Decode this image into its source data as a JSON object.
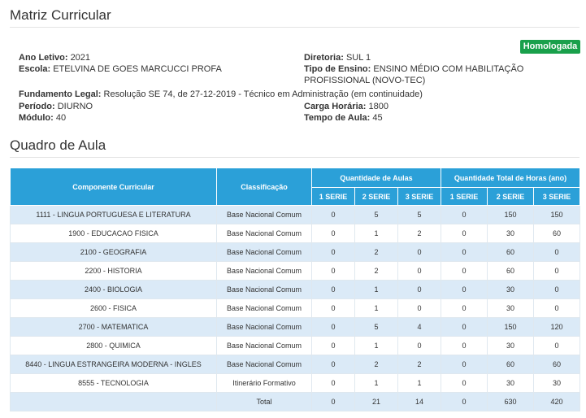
{
  "page_title": "Matriz Curricular",
  "status_badge": "Homologada",
  "info": {
    "ano_letivo_label": "Ano Letivo:",
    "ano_letivo": "2021",
    "escola_label": "Escola:",
    "escola": "ETELVINA DE GOES MARCUCCI PROFA",
    "diretoria_label": "Diretoria:",
    "diretoria": "SUL 1",
    "tipo_label": "Tipo de Ensino:",
    "tipo_line1": "ENSINO MÉDIO COM HABILITAÇÃO",
    "tipo_line2": "PROFISSIONAL (NOVO-TEC)",
    "fundamento_label": "Fundamento Legal:",
    "fundamento": "Resolução SE 74, de 27-12-2019 - Técnico em Administração (em continuidade)",
    "periodo_label": "Período:",
    "periodo": "DIURNO",
    "carga_label": "Carga Horária:",
    "carga": "1800",
    "modulo_label": "Módulo:",
    "modulo": "40",
    "tempo_label": "Tempo de Aula:",
    "tempo": "45"
  },
  "section_title": "Quadro de Aula",
  "table": {
    "h_componente": "Componente Curricular",
    "h_classificacao": "Classificação",
    "h_qtd_aulas": "Quantidade de Aulas",
    "h_qtd_horas": "Quantidade Total de Horas (ano)",
    "serie_labels": [
      "1 SERIE",
      "2 SERIE",
      "3 SERIE"
    ],
    "rows": [
      {
        "componente": "1111 - LINGUA PORTUGUESA E LITERATURA",
        "classificacao": "Base Nacional Comum",
        "a1": "0",
        "a2": "5",
        "a3": "5",
        "h1": "0",
        "h2": "150",
        "h3": "150"
      },
      {
        "componente": "1900 - EDUCACAO FISICA",
        "classificacao": "Base Nacional Comum",
        "a1": "0",
        "a2": "1",
        "a3": "2",
        "h1": "0",
        "h2": "30",
        "h3": "60"
      },
      {
        "componente": "2100 - GEOGRAFIA",
        "classificacao": "Base Nacional Comum",
        "a1": "0",
        "a2": "2",
        "a3": "0",
        "h1": "0",
        "h2": "60",
        "h3": "0"
      },
      {
        "componente": "2200 - HISTORIA",
        "classificacao": "Base Nacional Comum",
        "a1": "0",
        "a2": "2",
        "a3": "0",
        "h1": "0",
        "h2": "60",
        "h3": "0"
      },
      {
        "componente": "2400 - BIOLOGIA",
        "classificacao": "Base Nacional Comum",
        "a1": "0",
        "a2": "1",
        "a3": "0",
        "h1": "0",
        "h2": "30",
        "h3": "0"
      },
      {
        "componente": "2600 - FISICA",
        "classificacao": "Base Nacional Comum",
        "a1": "0",
        "a2": "1",
        "a3": "0",
        "h1": "0",
        "h2": "30",
        "h3": "0"
      },
      {
        "componente": "2700 - MATEMATICA",
        "classificacao": "Base Nacional Comum",
        "a1": "0",
        "a2": "5",
        "a3": "4",
        "h1": "0",
        "h2": "150",
        "h3": "120"
      },
      {
        "componente": "2800 - QUIMICA",
        "classificacao": "Base Nacional Comum",
        "a1": "0",
        "a2": "1",
        "a3": "0",
        "h1": "0",
        "h2": "30",
        "h3": "0"
      },
      {
        "componente": "8440 - LINGUA ESTRANGEIRA MODERNA - INGLES",
        "classificacao": "Base Nacional Comum",
        "a1": "0",
        "a2": "2",
        "a3": "2",
        "h1": "0",
        "h2": "60",
        "h3": "60"
      },
      {
        "componente": "8555 - TECNOLOGIA",
        "classificacao": "Itinerário Formativo",
        "a1": "0",
        "a2": "1",
        "a3": "1",
        "h1": "0",
        "h2": "30",
        "h3": "30"
      }
    ],
    "total": {
      "label": "Total",
      "a1": "0",
      "a2": "21",
      "a3": "14",
      "h1": "0",
      "h2": "630",
      "h3": "420"
    }
  }
}
